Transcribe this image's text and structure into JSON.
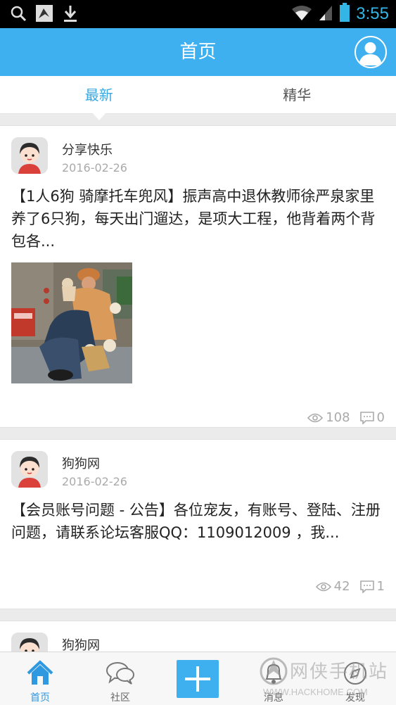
{
  "statusbar": {
    "time": "3:55"
  },
  "header": {
    "title": "首页"
  },
  "tabs": [
    {
      "label": "最新"
    },
    {
      "label": "精华"
    }
  ],
  "posts": [
    {
      "author": "分享快乐",
      "date": "2016-02-26",
      "text": "【1人6狗 骑摩托车兜风】振声高中退休教师徐严泉家里养了6只狗，每天出门遛达，是项大工程，他背着两个背包各...",
      "views": "108",
      "comments": "0"
    },
    {
      "author": "狗狗网",
      "date": "2016-02-26",
      "text": "【会员账号问题 - 公告】各位宠友，有账号、登陆、注册问题，请联系论坛客服QQ：1109012009 ，我...",
      "views": "42",
      "comments": "1"
    },
    {
      "author": "狗狗网"
    }
  ],
  "bottomnav": {
    "home": "首页",
    "community": "社区",
    "messages": "消息",
    "discover": "发现"
  },
  "watermark": {
    "cn": "网侠手机站",
    "url": "WWW.HACKHOME.COM"
  },
  "colors": {
    "primary": "#3fb0ef",
    "active_tab": "#3aa7e0",
    "clock": "#33b5e5"
  }
}
